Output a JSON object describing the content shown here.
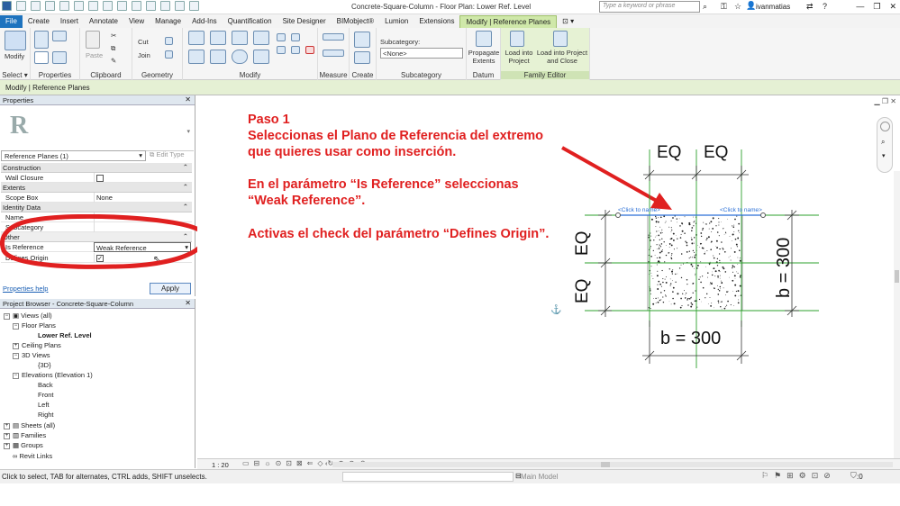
{
  "app": {
    "window_title": "Concrete-Square-Column - Floor Plan: Lower Ref. Level",
    "search_placeholder": "Type a keyword or phrase",
    "user": "ivanmatias"
  },
  "tabs": [
    {
      "label": "File"
    },
    {
      "label": "Create"
    },
    {
      "label": "Insert"
    },
    {
      "label": "Annotate"
    },
    {
      "label": "View"
    },
    {
      "label": "Manage"
    },
    {
      "label": "Add-Ins"
    },
    {
      "label": "Quantification"
    },
    {
      "label": "Site Designer"
    },
    {
      "label": "BIMobject®"
    },
    {
      "label": "Lumion"
    },
    {
      "label": "Extensions"
    },
    {
      "label": "Modify | Reference Planes"
    }
  ],
  "ribbon": {
    "modify_label": "Modify",
    "select_label": "Select ▾",
    "properties_label": "Properties",
    "clipboard_label": "Clipboard",
    "paste_label": "Paste",
    "cut_label": "Cut",
    "join_label": "Join",
    "geometry_label": "Geometry",
    "modify_group_label": "Modify",
    "measure_label": "Measure",
    "create_label": "Create",
    "subcategory_title": "Subcategory:",
    "subcategory_value": "<None>",
    "subcategory_label": "Subcategory",
    "propagate_label": "Propagate Extents",
    "datum_label": "Datum",
    "load_project_label": "Load into Project",
    "load_close_label": "Load into Project and Close",
    "family_editor_label": "Family Editor"
  },
  "options_bar": {
    "text": "Modify | Reference Planes"
  },
  "properties": {
    "title": "Properties",
    "type_selector": "Reference Planes (1)",
    "edit_type": "Edit Type",
    "sections": {
      "construction": "Construction",
      "extents": "Extents",
      "identity": "Identity Data",
      "other": "Other"
    },
    "rows": {
      "wall_closure": "Wall Closure",
      "scope_box": "Scope Box",
      "scope_box_value": "None",
      "name": "Name",
      "subcategory": "Subcategory",
      "is_reference": "Is Reference",
      "is_reference_value": "Weak Reference",
      "defines_origin": "Defines Origin"
    },
    "help_link": "Properties help",
    "apply": "Apply"
  },
  "browser": {
    "title": "Project Browser - Concrete-Square-Column",
    "items": {
      "views": "Views (all)",
      "floor_plans": "Floor Plans",
      "lower_ref": "Lower Ref. Level",
      "ceiling": "Ceiling Plans",
      "views3d": "3D Views",
      "v3d": "{3D}",
      "elevations": "Elevations (Elevation 1)",
      "back": "Back",
      "front": "Front",
      "left": "Left",
      "right": "Right",
      "sheets": "Sheets (all)",
      "families": "Families",
      "groups": "Groups",
      "links": "Revit Links"
    }
  },
  "annotation": {
    "line1": "Paso 1",
    "line2": "Seleccionas el Plano de Referencia del extremo",
    "line3": "que quieres usar como inserción.",
    "line4": "En el parámetro “Is Reference” seleccionas",
    "line5": "“Weak Reference”.",
    "line6": "Activas el check del parámetro “Defines Origin”."
  },
  "drawing": {
    "eq_label": "EQ",
    "b_label": "b = 300",
    "click_to_name": "<Click to name>"
  },
  "viewbar": {
    "scale": "1 : 20"
  },
  "status": {
    "hint": "Click to select, TAB for alternates, CTRL adds, SHIFT unselects.",
    "model": "Main Model",
    "filter_count": ":0"
  },
  "colors": {
    "annotation_red": "#e02020",
    "ref_plane_green": "#2ca02c",
    "context_tab_green": "#cfe8a9"
  }
}
